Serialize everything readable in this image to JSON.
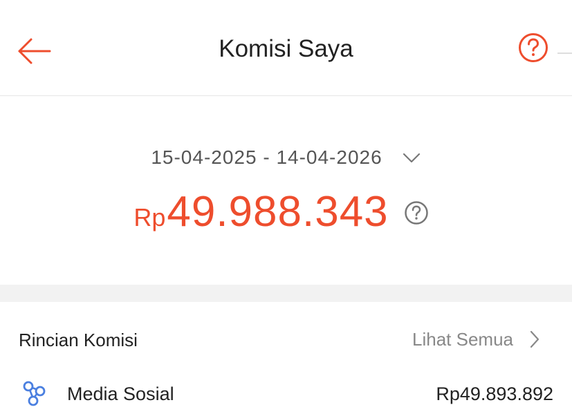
{
  "header": {
    "title": "Komisi Saya",
    "back_icon": "arrow-left-icon",
    "help_icon": "question-circle-icon",
    "accent_color": "#ee4d2d"
  },
  "summary": {
    "date_range": "15-04-2025 - 14-04-2026",
    "dropdown_icon": "chevron-down-icon",
    "currency": "Rp",
    "amount": "49.988.343",
    "amount_help_icon": "question-circle-icon",
    "amount_color": "#ee4d2d"
  },
  "details": {
    "title": "Rincian Komisi",
    "see_all_label": "Lihat Semua",
    "see_all_icon": "chevron-right-icon",
    "items": [
      {
        "icon": "share-nodes-icon",
        "label": "Media Sosial",
        "value": "Rp49.893.892"
      }
    ]
  }
}
